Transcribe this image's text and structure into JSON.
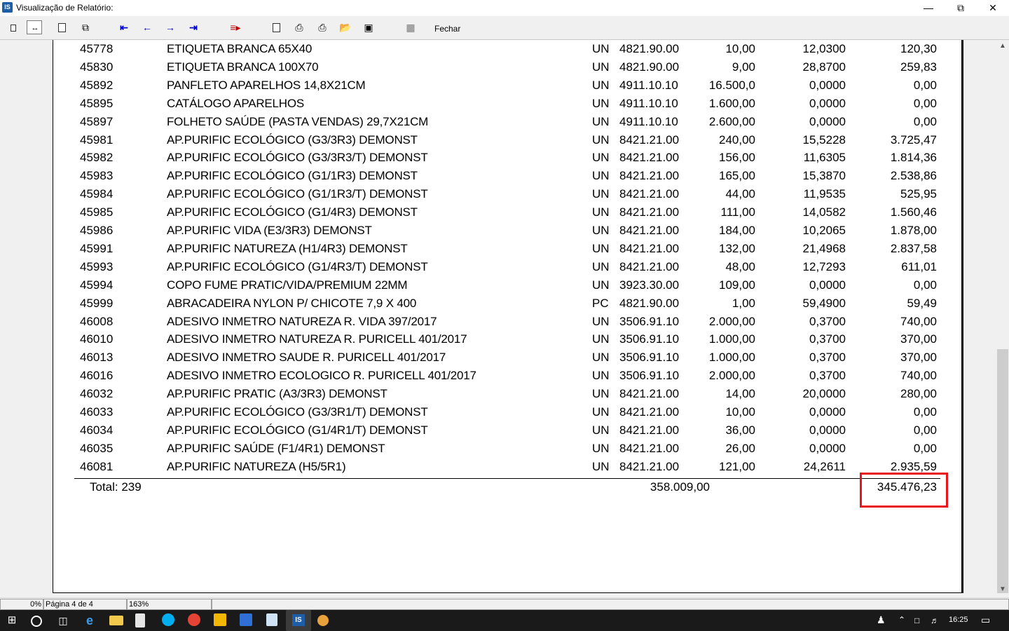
{
  "window": {
    "title": "Visualização de Relatório:",
    "app_icon_label": "IS"
  },
  "toolbar": {
    "close_label": "Fechar",
    "icons": [
      "whole-page-icon",
      "page-width-icon",
      "single-page-icon",
      "multi-page-icon",
      "first-page-icon",
      "previous-page-icon",
      "next-page-icon",
      "last-page-icon",
      "goto-page-icon",
      "copy-icon",
      "print-setup-icon",
      "print-icon",
      "open-icon",
      "save-icon",
      "export-icon"
    ]
  },
  "report": {
    "rows": [
      {
        "code": "45778",
        "desc": "ETIQUETA  BRANCA  65X40",
        "un": "UN",
        "ncm": "4821.90.00",
        "qty": "10,00",
        "price": "12,0300",
        "total": "120,30"
      },
      {
        "code": "45830",
        "desc": "ETIQUETA  BRANCA 100X70",
        "un": "UN",
        "ncm": "4821.90.00",
        "qty": "9,00",
        "price": "28,8700",
        "total": "259,83"
      },
      {
        "code": "45892",
        "desc": "PANFLETO APARELHOS 14,8X21CM",
        "un": "UN",
        "ncm": "4911.10.10",
        "qty": "16.500,0",
        "price": "0,0000",
        "total": "0,00"
      },
      {
        "code": "45895",
        "desc": "CATÁLOGO APARELHOS",
        "un": "UN",
        "ncm": "4911.10.10",
        "qty": "1.600,00",
        "price": "0,0000",
        "total": "0,00"
      },
      {
        "code": "45897",
        "desc": "FOLHETO SAÚDE (PASTA VENDAS) 29,7X21CM",
        "un": "UN",
        "ncm": "4911.10.10",
        "qty": "2.600,00",
        "price": "0,0000",
        "total": "0,00"
      },
      {
        "code": "45981",
        "desc": "AP.PURIFIC ECOLÓGICO (G3/3R3) DEMONST",
        "un": "UN",
        "ncm": "8421.21.00",
        "qty": "240,00",
        "price": "15,5228",
        "total": "3.725,47"
      },
      {
        "code": "45982",
        "desc": "AP.PURIFIC ECOLÓGICO (G3/3R3/T) DEMONST",
        "un": "UN",
        "ncm": "8421.21.00",
        "qty": "156,00",
        "price": "11,6305",
        "total": "1.814,36"
      },
      {
        "code": "45983",
        "desc": "AP.PURIFIC ECOLÓGICO (G1/1R3) DEMONST",
        "un": "UN",
        "ncm": "8421.21.00",
        "qty": "165,00",
        "price": "15,3870",
        "total": "2.538,86"
      },
      {
        "code": "45984",
        "desc": "AP.PURIFIC ECOLÓGICO (G1/1R3/T) DEMONST",
        "un": "UN",
        "ncm": "8421.21.00",
        "qty": "44,00",
        "price": "11,9535",
        "total": "525,95"
      },
      {
        "code": "45985",
        "desc": "AP.PURIFIC ECOLÓGICO (G1/4R3) DEMONST",
        "un": "UN",
        "ncm": "8421.21.00",
        "qty": "111,00",
        "price": "14,0582",
        "total": "1.560,46"
      },
      {
        "code": "45986",
        "desc": "AP.PURIFIC VIDA (E3/3R3) DEMONST",
        "un": "UN",
        "ncm": "8421.21.00",
        "qty": "184,00",
        "price": "10,2065",
        "total": "1.878,00"
      },
      {
        "code": "45991",
        "desc": "AP.PURIFIC NATUREZA (H1/4R3) DEMONST",
        "un": "UN",
        "ncm": "8421.21.00",
        "qty": "132,00",
        "price": "21,4968",
        "total": "2.837,58"
      },
      {
        "code": "45993",
        "desc": "AP.PURIFIC ECOLÓGICO (G1/4R3/T) DEMONST",
        "un": "UN",
        "ncm": "8421.21.00",
        "qty": "48,00",
        "price": "12,7293",
        "total": "611,01"
      },
      {
        "code": "45994",
        "desc": "COPO FUME PRATIC/VIDA/PREMIUM 22MM",
        "un": "UN",
        "ncm": "3923.30.00",
        "qty": "109,00",
        "price": "0,0000",
        "total": "0,00"
      },
      {
        "code": "45999",
        "desc": "ABRACADEIRA NYLON P/ CHICOTE 7,9 X 400",
        "un": "PC",
        "ncm": "4821.90.00",
        "qty": "1,00",
        "price": "59,4900",
        "total": "59,49"
      },
      {
        "code": "46008",
        "desc": "ADESIVO INMETRO NATUREZA  R. VIDA 397/2017",
        "un": "UN",
        "ncm": "3506.91.10",
        "qty": "2.000,00",
        "price": "0,3700",
        "total": "740,00"
      },
      {
        "code": "46010",
        "desc": "ADESIVO INMETRO NATUREZA  R. PURICELL 401/2017",
        "un": "UN",
        "ncm": "3506.91.10",
        "qty": "1.000,00",
        "price": "0,3700",
        "total": "370,00"
      },
      {
        "code": "46013",
        "desc": "ADESIVO INMETRO SAUDE R. PURICELL 401/2017",
        "un": "UN",
        "ncm": "3506.91.10",
        "qty": "1.000,00",
        "price": "0,3700",
        "total": "370,00"
      },
      {
        "code": "46016",
        "desc": "ADESIVO INMETRO ECOLOGICO R. PURICELL 401/2017",
        "un": "UN",
        "ncm": "3506.91.10",
        "qty": "2.000,00",
        "price": "0,3700",
        "total": "740,00"
      },
      {
        "code": "46032",
        "desc": "AP.PURIFIC PRATIC (A3/3R3) DEMONST",
        "un": "UN",
        "ncm": "8421.21.00",
        "qty": "14,00",
        "price": "20,0000",
        "total": "280,00"
      },
      {
        "code": "46033",
        "desc": "AP.PURIFIC ECOLÓGICO (G3/3R1/T) DEMONST",
        "un": "UN",
        "ncm": "8421.21.00",
        "qty": "10,00",
        "price": "0,0000",
        "total": "0,00"
      },
      {
        "code": "46034",
        "desc": "AP.PURIFIC ECOLÓGICO (G1/4R1/T) DEMONST",
        "un": "UN",
        "ncm": "8421.21.00",
        "qty": "36,00",
        "price": "0,0000",
        "total": "0,00"
      },
      {
        "code": "46035",
        "desc": "AP.PURIFIC SAÚDE (F1/4R1) DEMONST",
        "un": "UN",
        "ncm": "8421.21.00",
        "qty": "26,00",
        "price": "0,0000",
        "total": "0,00"
      },
      {
        "code": "46081",
        "desc": "AP.PURIFIC NATUREZA (H5/5R1)",
        "un": "UN",
        "ncm": "8421.21.00",
        "qty": "121,00",
        "price": "24,2611",
        "total": "2.935,59"
      }
    ],
    "totals": {
      "label": "Total: 239",
      "qty": "358.009,00",
      "value": "345.476,23"
    },
    "highlight_color": "#e8141c"
  },
  "statusbar": {
    "progress": "0%",
    "page": "Página 4 de 4",
    "zoom": "163%"
  },
  "taskbar": {
    "time": "16:25",
    "apps": [
      "start-icon",
      "search-icon",
      "task-view-icon",
      "edge-icon",
      "file-explorer-icon",
      "calculator-icon",
      "skype-icon",
      "chrome-icon",
      "outlook-icon",
      "remote-app-icon",
      "notepad-icon",
      "is-app-icon",
      "paint-icon"
    ]
  }
}
